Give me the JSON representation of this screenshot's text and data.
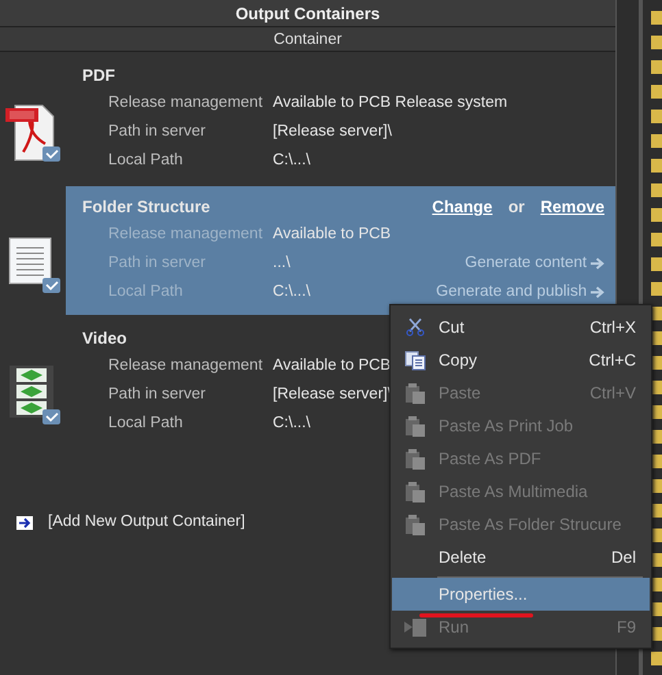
{
  "panel": {
    "title": "Output Containers",
    "column_header": "Container"
  },
  "containers": [
    {
      "title": "PDF",
      "kind": "pdf",
      "selected": false,
      "rows": [
        {
          "label": "Release management",
          "value": "Available to PCB Release system"
        },
        {
          "label": "Path in server",
          "value": "[Release server]\\"
        },
        {
          "label": "Local Path",
          "value": "C:\\...\\"
        }
      ]
    },
    {
      "title": "Folder Structure",
      "kind": "document",
      "selected": true,
      "links": [
        "Change",
        "or",
        "Remove"
      ],
      "actions": [
        "Generate content",
        "Generate and publish"
      ],
      "rows": [
        {
          "label": "Release management",
          "value": "Available to PCB"
        },
        {
          "label": "Path in server",
          "value": "...\\"
        },
        {
          "label": "Local Path",
          "value": "C:\\...\\"
        }
      ]
    },
    {
      "title": "Video",
      "kind": "video",
      "selected": false,
      "rows": [
        {
          "label": "Release management",
          "value": "Available to PCB"
        },
        {
          "label": "Path in server",
          "value": "[Release server]\\"
        },
        {
          "label": "Local Path",
          "value": "C:\\...\\"
        }
      ]
    }
  ],
  "add_container": "[Add New Output Container]",
  "context_menu": [
    {
      "kind": "cut",
      "label": "Cut",
      "shortcut": "Ctrl+X",
      "disabled": false,
      "selected": false
    },
    {
      "kind": "copy",
      "label": "Copy",
      "shortcut": "Ctrl+C",
      "disabled": false,
      "selected": false
    },
    {
      "kind": "paste",
      "label": "Paste",
      "shortcut": "Ctrl+V",
      "disabled": true,
      "selected": false
    },
    {
      "kind": "paste",
      "label": "Paste As Print Job",
      "disabled": true,
      "selected": false
    },
    {
      "kind": "paste",
      "label": "Paste As PDF",
      "disabled": true,
      "selected": false
    },
    {
      "kind": "paste",
      "label": "Paste As Multimedia",
      "disabled": true,
      "selected": false
    },
    {
      "kind": "paste",
      "label": "Paste As Folder Strucure",
      "disabled": true,
      "selected": false
    },
    {
      "kind": "item",
      "label": "Delete",
      "shortcut": "Del",
      "disabled": false,
      "selected": false
    },
    {
      "kind": "separator"
    },
    {
      "kind": "item",
      "label": "Properties...",
      "disabled": false,
      "selected": true,
      "underlined": true
    },
    {
      "kind": "run",
      "label": "Run",
      "shortcut": "F9",
      "disabled": true,
      "selected": false
    }
  ]
}
